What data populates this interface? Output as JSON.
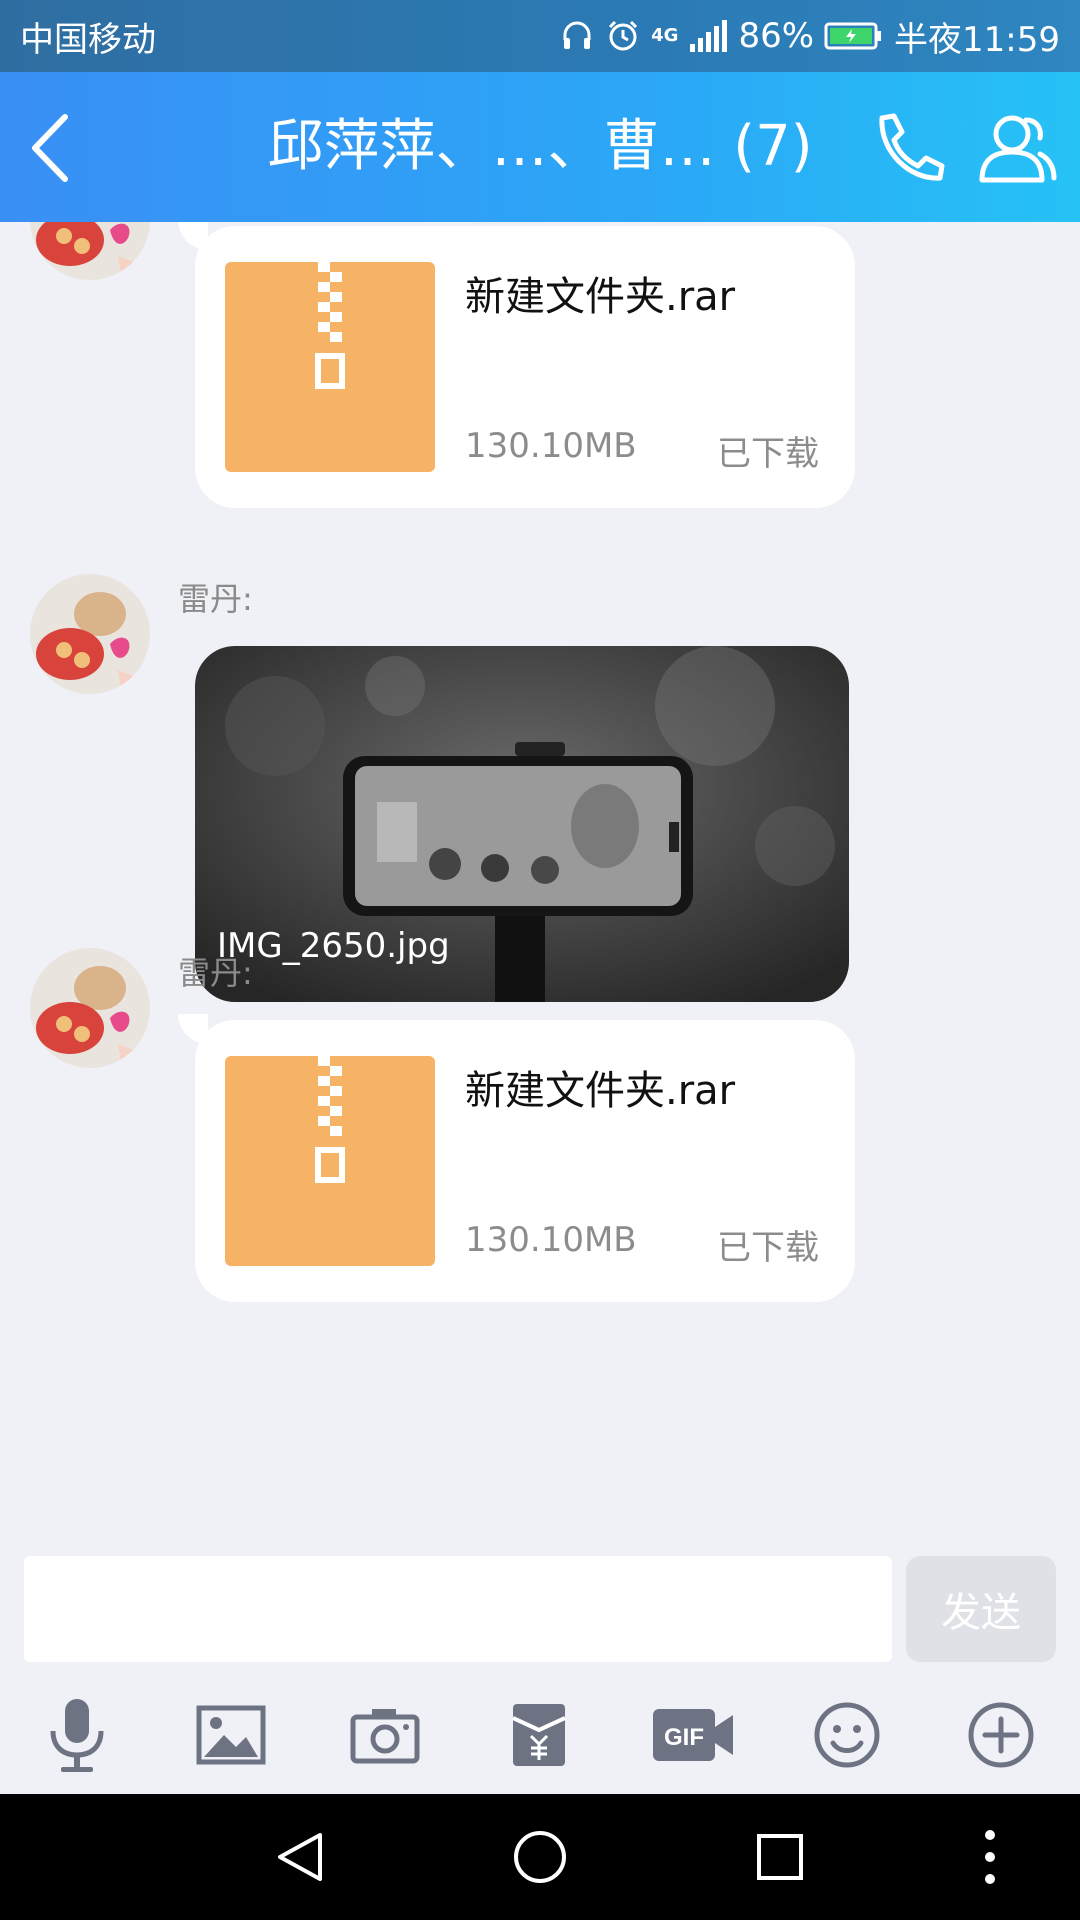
{
  "status_bar": {
    "carrier": "中国移动",
    "network": "4G",
    "battery": "86%",
    "time": "半夜11:59"
  },
  "header": {
    "title": "邱萍萍、…、曹… (7)",
    "icons": [
      "back-arrow-icon",
      "phone-icon",
      "members-icon"
    ]
  },
  "messages": [
    {
      "type": "file",
      "file_name": "新建文件夹.rar",
      "size": "130.10MB",
      "status": "已下载"
    },
    {
      "type": "image",
      "sender": "雷丹:",
      "caption": "IMG_2650.jpg"
    },
    {
      "type": "file",
      "sender": "雷丹:",
      "file_name": "新建文件夹.rar",
      "size": "130.10MB",
      "status": "已下载"
    }
  ],
  "input": {
    "value": "",
    "send_label": "发送"
  },
  "toolbar": {
    "icons": [
      "microphone-icon",
      "picture-icon",
      "camera-icon",
      "red-envelope-icon",
      "gif-icon",
      "emoji-icon",
      "plus-icon"
    ]
  },
  "nav": {
    "icons": [
      "back-triangle-icon",
      "home-circle-icon",
      "recents-square-icon",
      "more-dots-icon"
    ]
  },
  "colors": {
    "header_start": "#3a8ff5",
    "header_end": "#26c2f6",
    "chat_bg": "#eff1f6",
    "file_thumb": "#f7b365",
    "icon_gray": "#6e7383"
  }
}
